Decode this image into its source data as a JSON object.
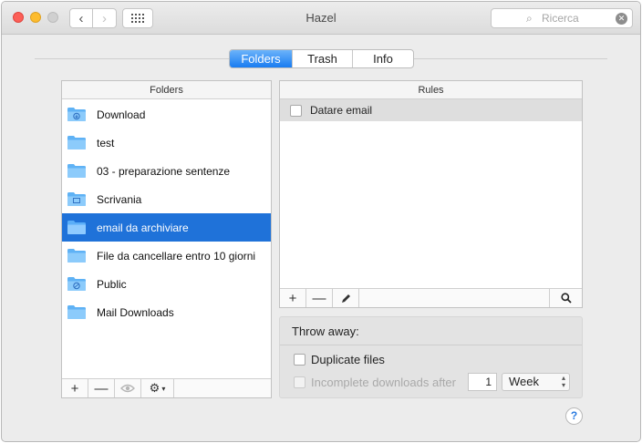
{
  "window": {
    "title": "Hazel"
  },
  "search": {
    "placeholder": "Ricerca"
  },
  "tabs": [
    {
      "label": "Folders",
      "active": true
    },
    {
      "label": "Trash",
      "active": false
    },
    {
      "label": "Info",
      "active": false
    }
  ],
  "folders": {
    "header": "Folders",
    "selected_index": 4,
    "items": [
      {
        "label": "Download",
        "icon": "download-folder-icon"
      },
      {
        "label": "test",
        "icon": "folder-icon"
      },
      {
        "label": "03 - preparazione sentenze",
        "icon": "folder-icon"
      },
      {
        "label": "Scrivania",
        "icon": "desktop-folder-icon"
      },
      {
        "label": "email da archiviare",
        "icon": "folder-icon"
      },
      {
        "label": "File da cancellare entro 10 giorni",
        "icon": "folder-icon"
      },
      {
        "label": "Public",
        "icon": "public-folder-icon"
      },
      {
        "label": "Mail Downloads",
        "icon": "folder-icon"
      }
    ],
    "toolbar": {
      "add": "+",
      "remove": "—",
      "eye": "eye-icon",
      "gear": "gear-icon"
    }
  },
  "rules": {
    "header": "Rules",
    "items": [
      {
        "label": "Datare email",
        "enabled": false
      }
    ],
    "toolbar": {
      "add": "+",
      "remove": "—",
      "edit": "pencil-icon",
      "search": "magnifier-icon"
    }
  },
  "throw_away": {
    "title": "Throw away:",
    "duplicate_files": {
      "label": "Duplicate files",
      "checked": false
    },
    "incomplete_downloads": {
      "label": "Incomplete downloads after",
      "checked": false,
      "enabled": false
    },
    "after_value": "1",
    "after_unit": "Week"
  },
  "colors": {
    "accent": "#1f72d9",
    "close": "#fc5f57",
    "minimize": "#fdbc2e"
  }
}
